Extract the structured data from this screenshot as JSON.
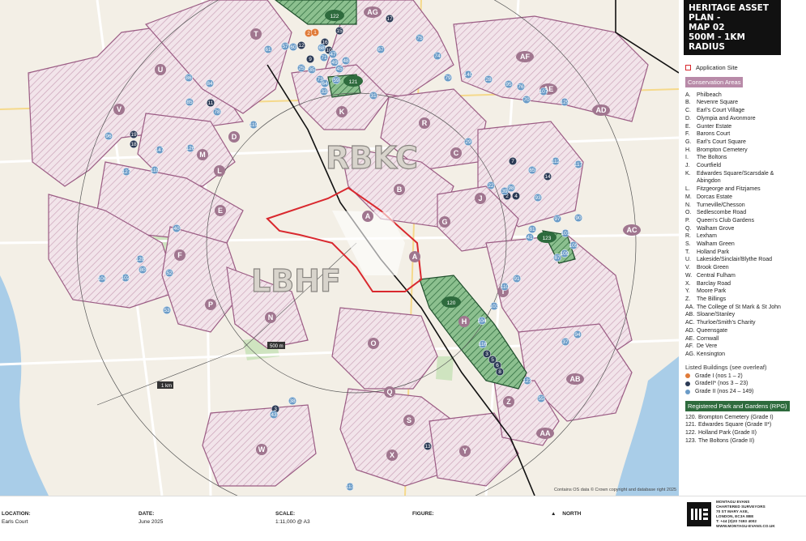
{
  "title_lines": [
    "HERITAGE ASSET PLAN -",
    "MAP 02",
    "500M - 1KM RADIUS"
  ],
  "legend": {
    "application_site": "Application Site",
    "conservation_areas_heading": "Conservation Areas",
    "conservation_areas": [
      {
        "code": "A.",
        "name": "Philbeach"
      },
      {
        "code": "B.",
        "name": "Nevenre Square"
      },
      {
        "code": "C.",
        "name": "Earl's Court Village"
      },
      {
        "code": "D.",
        "name": "Olympia and Avonmore"
      },
      {
        "code": "E.",
        "name": "Gunter Estate"
      },
      {
        "code": "F.",
        "name": "Barons Court"
      },
      {
        "code": "G.",
        "name": "Earl's Court Square"
      },
      {
        "code": "H.",
        "name": "Brompton Cemetery"
      },
      {
        "code": "I.",
        "name": "The Boltons"
      },
      {
        "code": "J.",
        "name": "Courtfield"
      },
      {
        "code": "K.",
        "name": "Edwardes Square/Scarsdale &"
      },
      {
        "code": "",
        "name": "Abingdon"
      },
      {
        "code": "L.",
        "name": "Fitzgeorge and Fitzjames"
      },
      {
        "code": "M.",
        "name": "Dorcas Estate"
      },
      {
        "code": "N.",
        "name": "Turneville/Chesson"
      },
      {
        "code": "O.",
        "name": "Sedlescombe Road"
      },
      {
        "code": "P.",
        "name": "Queen's Club Gardens"
      },
      {
        "code": "Q.",
        "name": "Walham Grove"
      },
      {
        "code": "R.",
        "name": "Lexham"
      },
      {
        "code": "S.",
        "name": "Walham Green"
      },
      {
        "code": "T.",
        "name": "Holland Park"
      },
      {
        "code": "U.",
        "name": "Lakeside/Sinclair/Blythe Road"
      },
      {
        "code": "V.",
        "name": "Brook Green"
      },
      {
        "code": "W.",
        "name": "Central Fulham"
      },
      {
        "code": "X.",
        "name": "Barclay Road"
      },
      {
        "code": "Y.",
        "name": "Moore Park"
      },
      {
        "code": "Z.",
        "name": "The Billings"
      },
      {
        "code": "AA.",
        "name": "The College of St Mark & St John"
      },
      {
        "code": "AB.",
        "name": "Sloane/Stanley"
      },
      {
        "code": "AC.",
        "name": "Thurloe/Smith's Charity"
      },
      {
        "code": "AD.",
        "name": "Queensgate"
      },
      {
        "code": "AE.",
        "name": "Cornwall"
      },
      {
        "code": "AF.",
        "name": "De Vere"
      },
      {
        "code": "AG.",
        "name": "Kensington"
      }
    ],
    "listed_buildings_heading": "Listed Buildings (see overleaf)",
    "listed_buildings": [
      {
        "label": "Grade I (nos 1 – 2)",
        "color": "#e07b39"
      },
      {
        "label": "GradeII* (nos 3 – 23)",
        "color": "#2b3a55"
      },
      {
        "label": "Grade II (nos 24 – 149)",
        "color": "#6a9bc7"
      }
    ],
    "rpg_heading": "Registered Park and Gardens (RPG)",
    "rpg": [
      {
        "code": "120.",
        "name": "Brompton Cemetery (Grade I)"
      },
      {
        "code": "121.",
        "name": "Edwardes Square (Grade II*)"
      },
      {
        "code": "122.",
        "name": "Holland Park (Grade II)"
      },
      {
        "code": "123.",
        "name": "The Boltons (Grade II)"
      }
    ]
  },
  "map": {
    "borough_labels": [
      "RBKC",
      "LBHF"
    ],
    "radius_labels": [
      "500 m",
      "1 km"
    ],
    "copyright": "Contains OS data © Crown copyright and database right 2025",
    "colors": {
      "site": "#d9282e",
      "ca_fill": "#b88aa8",
      "rpg": "#2e6b3d",
      "grade1": "#e07b39",
      "grade2star": "#2b3a55",
      "grade2": "#6a9bc7"
    },
    "ca_markers": [
      {
        "id": "A"
      },
      {
        "id": "A"
      },
      {
        "id": "B"
      },
      {
        "id": "C"
      },
      {
        "id": "D"
      },
      {
        "id": "E"
      },
      {
        "id": "F"
      },
      {
        "id": "G"
      },
      {
        "id": "H"
      },
      {
        "id": "I"
      },
      {
        "id": "J"
      },
      {
        "id": "K"
      },
      {
        "id": "L"
      },
      {
        "id": "M"
      },
      {
        "id": "N"
      },
      {
        "id": "O"
      },
      {
        "id": "P"
      },
      {
        "id": "Q"
      },
      {
        "id": "R"
      },
      {
        "id": "S"
      },
      {
        "id": "T"
      },
      {
        "id": "U"
      },
      {
        "id": "V"
      },
      {
        "id": "W"
      },
      {
        "id": "X"
      },
      {
        "id": "Y"
      },
      {
        "id": "Z"
      },
      {
        "id": "AA"
      },
      {
        "id": "AB"
      },
      {
        "id": "AC"
      },
      {
        "id": "AD"
      },
      {
        "id": "AE"
      },
      {
        "id": "AF"
      },
      {
        "id": "AG"
      }
    ],
    "rpg_markers": [
      "120",
      "121",
      "122",
      "123"
    ],
    "listed_markers": [
      {
        "n": "2",
        "g": "I"
      },
      {
        "n": "1",
        "g": "I"
      },
      {
        "n": "2",
        "g": "II*"
      },
      {
        "n": "4",
        "g": "II*"
      },
      {
        "n": "7",
        "g": "II*"
      },
      {
        "n": "3",
        "g": "II*"
      },
      {
        "n": "14",
        "g": "II*"
      },
      {
        "n": "11",
        "g": "II*"
      },
      {
        "n": "18",
        "g": "II*"
      },
      {
        "n": "12",
        "g": "II*"
      },
      {
        "n": "9",
        "g": "II*"
      },
      {
        "n": "13",
        "g": "II*"
      },
      {
        "n": "15",
        "g": "II*"
      },
      {
        "n": "17",
        "g": "II*"
      },
      {
        "n": "6",
        "g": "II*"
      },
      {
        "n": "8",
        "g": "II*"
      },
      {
        "n": "10",
        "g": "II*"
      },
      {
        "n": "5",
        "g": "II*"
      },
      {
        "n": "16",
        "g": "II*"
      },
      {
        "n": "3",
        "g": "II*"
      },
      {
        "n": "19",
        "g": "II*"
      },
      {
        "n": "61",
        "g": "II"
      },
      {
        "n": "57",
        "g": "II"
      },
      {
        "n": "60",
        "g": "II"
      },
      {
        "n": "25",
        "g": "II"
      },
      {
        "n": "68",
        "g": "II"
      },
      {
        "n": "71",
        "g": "II"
      },
      {
        "n": "75",
        "g": "II"
      },
      {
        "n": "74",
        "g": "II"
      },
      {
        "n": "73",
        "g": "II"
      },
      {
        "n": "64",
        "g": "II"
      },
      {
        "n": "59",
        "g": "II"
      },
      {
        "n": "49",
        "g": "II"
      },
      {
        "n": "47",
        "g": "II"
      },
      {
        "n": "48",
        "g": "II"
      },
      {
        "n": "45",
        "g": "II"
      },
      {
        "n": "35",
        "g": "II"
      },
      {
        "n": "33",
        "g": "II"
      },
      {
        "n": "31",
        "g": "II"
      },
      {
        "n": "67",
        "g": "II"
      },
      {
        "n": "86",
        "g": "II"
      },
      {
        "n": "85",
        "g": "II"
      },
      {
        "n": "84",
        "g": "II"
      },
      {
        "n": "78",
        "g": "II"
      },
      {
        "n": "119",
        "g": "II"
      },
      {
        "n": "96",
        "g": "II"
      },
      {
        "n": "127",
        "g": "II"
      },
      {
        "n": "147",
        "g": "II"
      },
      {
        "n": "126",
        "g": "II"
      },
      {
        "n": "118",
        "g": "II"
      },
      {
        "n": "79",
        "g": "II"
      },
      {
        "n": "140",
        "g": "II"
      },
      {
        "n": "40",
        "g": "II"
      },
      {
        "n": "102",
        "g": "II"
      },
      {
        "n": "106",
        "g": "II"
      },
      {
        "n": "128",
        "g": "II"
      },
      {
        "n": "80",
        "g": "II"
      },
      {
        "n": "52",
        "g": "II"
      },
      {
        "n": "53",
        "g": "II"
      },
      {
        "n": "38",
        "g": "II"
      },
      {
        "n": "43",
        "g": "II"
      },
      {
        "n": "29",
        "g": "II"
      },
      {
        "n": "28",
        "g": "II"
      },
      {
        "n": "95",
        "g": "II"
      },
      {
        "n": "76",
        "g": "II"
      },
      {
        "n": "70",
        "g": "II"
      },
      {
        "n": "107",
        "g": "II"
      },
      {
        "n": "129",
        "g": "II"
      },
      {
        "n": "112",
        "g": "II"
      },
      {
        "n": "117",
        "g": "II"
      },
      {
        "n": "22",
        "g": "II"
      },
      {
        "n": "39",
        "g": "II"
      },
      {
        "n": "65",
        "g": "II"
      },
      {
        "n": "93",
        "g": "II"
      },
      {
        "n": "98",
        "g": "II"
      },
      {
        "n": "97",
        "g": "II"
      },
      {
        "n": "90",
        "g": "II"
      },
      {
        "n": "101",
        "g": "II"
      },
      {
        "n": "105",
        "g": "II"
      },
      {
        "n": "109",
        "g": "II"
      },
      {
        "n": "81",
        "g": "II"
      },
      {
        "n": "87",
        "g": "II"
      },
      {
        "n": "91",
        "g": "II"
      },
      {
        "n": "110",
        "g": "II"
      },
      {
        "n": "94",
        "g": "II"
      },
      {
        "n": "37",
        "g": "II"
      },
      {
        "n": "41",
        "g": "II"
      },
      {
        "n": "103",
        "g": "II"
      },
      {
        "n": "104",
        "g": "II"
      },
      {
        "n": "116",
        "g": "II"
      },
      {
        "n": "123",
        "g": "II"
      },
      {
        "n": "55",
        "g": "II"
      },
      {
        "n": "113",
        "g": "II"
      }
    ]
  },
  "footer": {
    "location_label": "LOCATION:",
    "location_value": "Earls Court",
    "date_label": "DATE:",
    "date_value": "June 2025",
    "scale_label": "SCALE:",
    "scale_value": "1:11,000 @ A3",
    "figure_label": "FIGURE:",
    "north_label": "NORTH",
    "brand_lines": [
      "MONTAGU EVANS",
      "CHARTERED SURVEYORS",
      "70 ST MARY AXE,",
      "LONDON, EC3A 8BE",
      "T: +44 (0)20 7493 4002",
      "WWW.MONTAGU-EVANS.CO.UK"
    ]
  }
}
